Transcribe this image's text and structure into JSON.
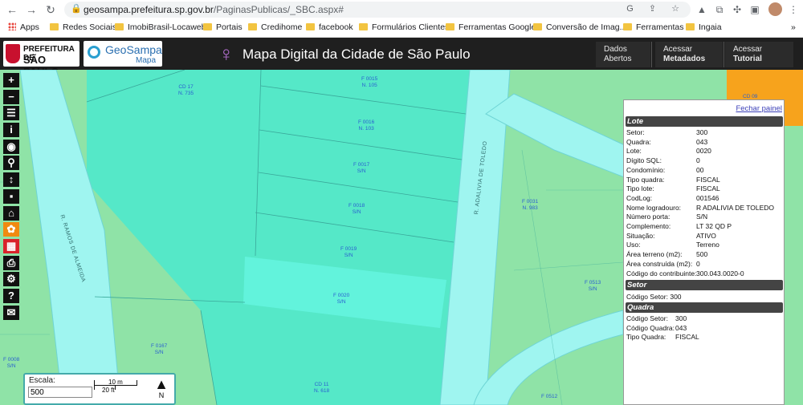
{
  "browser": {
    "url_host": "geosampa.prefeitura.sp.gov.br",
    "url_path": "/PaginasPublicas/_SBC.aspx#",
    "bookmarks": [
      "Apps",
      "Redes Sociais",
      "ImobiBrasil-Locaweb",
      "Portais",
      "Credihome",
      "facebook",
      "Formulários Clientes",
      "Ferramentas Google",
      "Conversão de Imag...",
      "Ferramentas",
      "Ingaia"
    ]
  },
  "header": {
    "prefeitura_line1": "PREFEITURA DE",
    "prefeitura_line2": "SÃO PAULO",
    "geosampa": "GeoSampa",
    "geosampa_sub": "Mapa",
    "title": "Mapa Digital da Cidade de São Paulo",
    "btn_dados_1": "Dados",
    "btn_dados_2": "Abertos",
    "btn_meta_1": "Acessar",
    "btn_meta_2": "Metadados",
    "btn_tut_1": "Acessar",
    "btn_tut_2": "Tutorial"
  },
  "map": {
    "labels": [
      {
        "t1": "CD 17",
        "t2": "N. 735"
      },
      {
        "t1": "F 0015",
        "t2": "N. 105"
      },
      {
        "t1": "F 0016",
        "t2": "N. 103"
      },
      {
        "t1": "F 0017",
        "t2": "S/N"
      },
      {
        "t1": "F 0018",
        "t2": "S/N"
      },
      {
        "t1": "F 0019",
        "t2": "S/N"
      },
      {
        "t1": "F 0020",
        "t2": "S/N"
      },
      {
        "t1": "F 0031",
        "t2": "N. 983"
      },
      {
        "t1": "F 0513",
        "t2": "S/N"
      },
      {
        "t1": "F 0167",
        "t2": "S/N"
      },
      {
        "t1": "F 0008",
        "t2": "S/N"
      },
      {
        "t1": "CD 11",
        "t2": "N. 618"
      },
      {
        "t1": "F 0512",
        "t2": ""
      },
      {
        "t1": "CD 09",
        "t2": ""
      }
    ],
    "street_1": "R. RAMOS DE ALMEIDA",
    "street_2": "R. ADALIVIA DE TOLEDO"
  },
  "scale": {
    "label": "Escala:",
    "value": "500",
    "meters": "10 m",
    "feet": "20 ft",
    "north": "N"
  },
  "panel": {
    "close": "Fechar painel",
    "lote_title": "Lote",
    "lote_rows": [
      {
        "k": "Setor:",
        "v": "300"
      },
      {
        "k": "Quadra:",
        "v": "043"
      },
      {
        "k": "Lote:",
        "v": "0020"
      },
      {
        "k": "Dígito SQL:",
        "v": "0"
      },
      {
        "k": "Condomínio:",
        "v": "00"
      },
      {
        "k": "Tipo quadra:",
        "v": "FISCAL"
      },
      {
        "k": "Tipo lote:",
        "v": "FISCAL"
      },
      {
        "k": "CodLog:",
        "v": "001546"
      },
      {
        "k": "Nome logradouro:",
        "v": "R ADALIVIA DE TOLEDO"
      },
      {
        "k": "Número porta:",
        "v": "S/N"
      },
      {
        "k": "Complemento:",
        "v": "LT 32 QD P"
      },
      {
        "k": "Situação:",
        "v": "ATIVO"
      },
      {
        "k": "Uso:",
        "v": "Terreno"
      },
      {
        "k": "Área terreno (m2):",
        "v": "500"
      },
      {
        "k": "Área construída (m2):",
        "v": "0"
      },
      {
        "k": "Código do contribuinte:",
        "v": "300.043.0020-0"
      }
    ],
    "setor_title": "Setor",
    "setor_row": "Código Setor:  300",
    "quadra_title": "Quadra",
    "quadra_rows": [
      {
        "k": "Código Setor:",
        "v": "300"
      },
      {
        "k": "Código Quadra:",
        "v": "043"
      },
      {
        "k": "Tipo Quadra:",
        "v": "FISCAL"
      }
    ]
  }
}
